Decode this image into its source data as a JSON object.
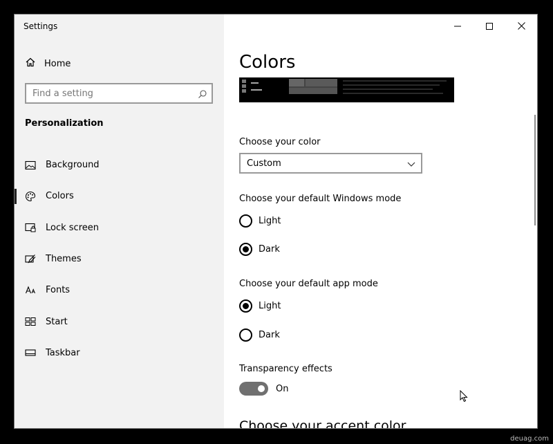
{
  "window": {
    "title": "Settings"
  },
  "sidebar": {
    "home_label": "Home",
    "search_placeholder": "Find a setting",
    "section_title": "Personalization",
    "items": [
      {
        "label": "Background",
        "icon": "picture-icon",
        "active": false
      },
      {
        "label": "Colors",
        "icon": "palette-icon",
        "active": true
      },
      {
        "label": "Lock screen",
        "icon": "lock-screen-icon",
        "active": false
      },
      {
        "label": "Themes",
        "icon": "brush-icon",
        "active": false
      },
      {
        "label": "Fonts",
        "icon": "font-icon",
        "active": false
      },
      {
        "label": "Start",
        "icon": "start-icon",
        "active": false
      },
      {
        "label": "Taskbar",
        "icon": "taskbar-icon",
        "active": false
      }
    ]
  },
  "main": {
    "title": "Colors",
    "choose_color_label": "Choose your color",
    "choose_color_value": "Custom",
    "windows_mode": {
      "label": "Choose your default Windows mode",
      "options": [
        {
          "label": "Light",
          "selected": false
        },
        {
          "label": "Dark",
          "selected": true
        }
      ]
    },
    "app_mode": {
      "label": "Choose your default app mode",
      "options": [
        {
          "label": "Light",
          "selected": true
        },
        {
          "label": "Dark",
          "selected": false
        }
      ]
    },
    "transparency": {
      "label": "Transparency effects",
      "state": "On"
    },
    "accent_heading": "Choose your accent color"
  },
  "watermark": "deuag.com",
  "colors": {
    "sidebar_bg": "#f2f2f2",
    "toggle_on": "#707070"
  }
}
